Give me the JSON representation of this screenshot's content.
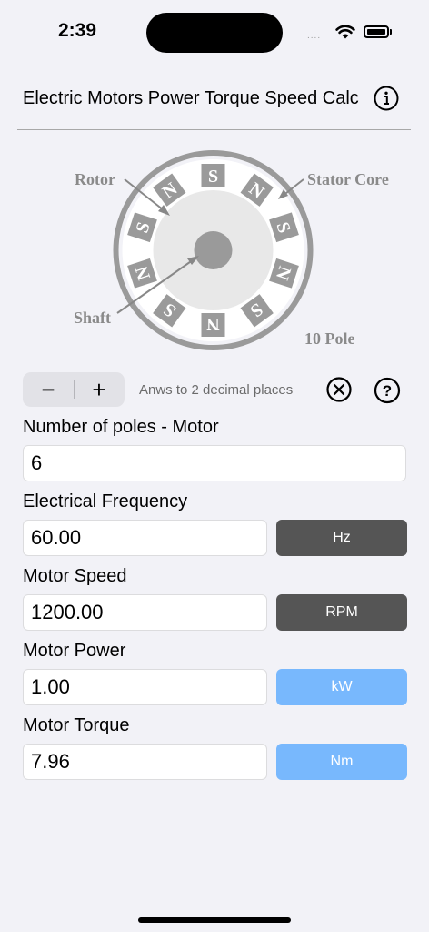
{
  "status_bar": {
    "time": "2:39",
    "signal": "....",
    "icons": [
      "wifi-icon",
      "battery-icon"
    ]
  },
  "nav": {
    "title": "Electric Motors Power Torque Speed Calc",
    "info_icon": "info-icon"
  },
  "diagram": {
    "labels": {
      "rotor": "Rotor",
      "stator": "Stator Core",
      "shaft": "Shaft",
      "pole_count": "10 Pole"
    },
    "poles": [
      "S",
      "N",
      "S",
      "N",
      "S",
      "N",
      "S",
      "N",
      "S",
      "N"
    ]
  },
  "toolbar": {
    "minus": "−",
    "plus": "+",
    "decimals": "Anws to 2 decimal places",
    "clear_icon": "clear-circle-icon",
    "help_icon": "help-circle-icon"
  },
  "fields": {
    "poles": {
      "label": "Number of poles - Motor",
      "value": "6"
    },
    "frequency": {
      "label": "Electrical Frequency",
      "value": "60.00",
      "unit": "Hz"
    },
    "speed": {
      "label": "Motor Speed",
      "value": "1200.00",
      "unit": "RPM"
    },
    "power": {
      "label": "Motor Power",
      "value": "1.00",
      "unit": "kW"
    },
    "torque": {
      "label": "Motor Torque",
      "value": "7.96",
      "unit": "Nm"
    }
  },
  "colors": {
    "unit_dark": "#555555",
    "unit_blue": "#78b8fd",
    "background": "#f2f2f7",
    "diagram_gray": "#9a9a9a"
  }
}
